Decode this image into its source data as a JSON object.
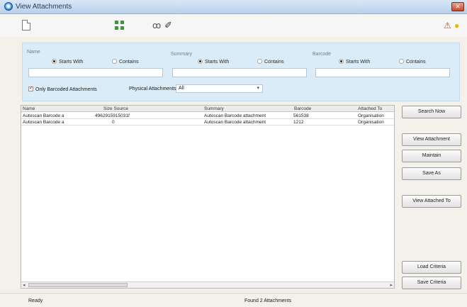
{
  "window": {
    "title": "View Attachments",
    "close_symbol": "✕"
  },
  "toolbar": {
    "icons": [
      "new-document-icon",
      "tree-icon",
      "find-icon",
      "clear-icon",
      "warning-icon",
      "lightbulb-icon"
    ]
  },
  "search": {
    "name": {
      "label": "Name",
      "starts_with": "Starts With",
      "contains": "Contains",
      "value": ""
    },
    "summary": {
      "label": "Summary",
      "starts_with": "Starts With",
      "contains": "Contains",
      "value": ""
    },
    "barcode": {
      "label": "Barcode",
      "starts_with": "Starts With",
      "contains": "Contains",
      "value": ""
    },
    "only_barcoded_label": "Only Barcoded Attachments",
    "only_barcoded_checked": true,
    "physical_label": "Physical Attachments",
    "physical_value": "All"
  },
  "table": {
    "columns": [
      "Name",
      "Size Source",
      "Summary",
      "Barcode",
      "Attached To"
    ],
    "rows": [
      [
        "Autoscan Barcode a",
        "4962915915031f",
        "Autoscan Barcode attachment",
        "561538",
        "Organisation"
      ],
      [
        "Autoscan Barcode a",
        "0",
        "Autoscan Barcode attachment",
        "1212",
        "Organisation"
      ]
    ]
  },
  "buttons": {
    "search_now": "Search Now",
    "view_attachment": "View Attachment",
    "maintain": "Maintain",
    "save_as": "Save As",
    "view_attached_to": "View Attached To",
    "load_criteria": "Load Criteria",
    "save_criteria": "Save Criteria"
  },
  "status": {
    "left": "Ready",
    "middle": "Found 2 Attachments"
  },
  "colors": {
    "panel": "#d9ecf7",
    "title_bar": "#c6dbf0",
    "close": "#c8482b"
  }
}
